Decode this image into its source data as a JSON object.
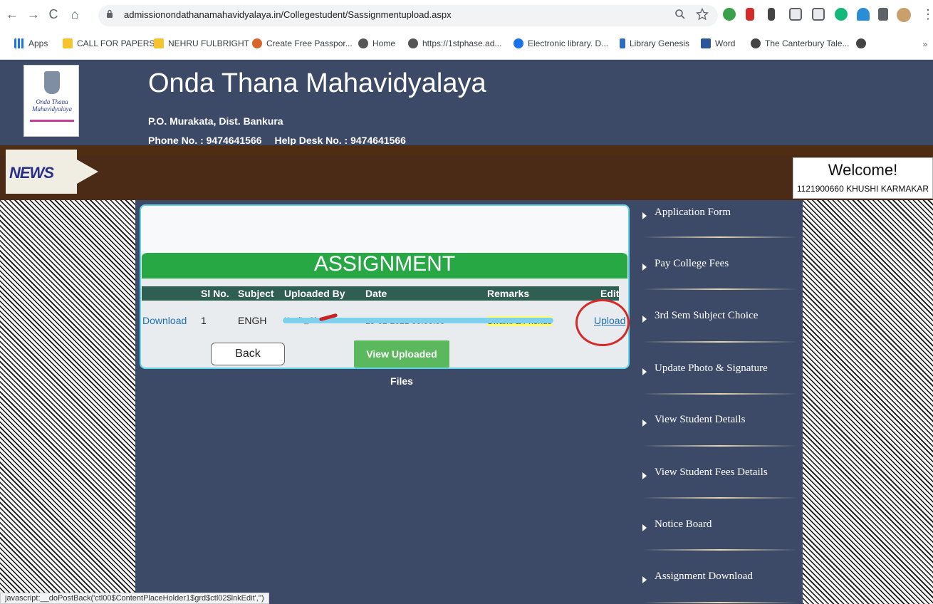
{
  "browser": {
    "url": "admissionondathanamahavidyalaya.in/Collegestudent/Sassignmentupload.aspx",
    "nav": {
      "back": "←",
      "forward": "→",
      "reload": "C",
      "home": "⌂"
    },
    "bookmarks": [
      {
        "label": "Apps",
        "color": "#1a73e8"
      },
      {
        "label": "CALL FOR PAPERS",
        "color": "#f4c430"
      },
      {
        "label": "NEHRU FULBRIGHT",
        "color": "#f4c430"
      },
      {
        "label": "Create Free Passpor...",
        "color": "#d9642a"
      },
      {
        "label": "Home",
        "color": "#555555"
      },
      {
        "label": "https://1stphase.ad...",
        "color": "#555555"
      },
      {
        "label": "Electronic library. D...",
        "color": "#1a73e8"
      },
      {
        "label": "Library Genesis",
        "color": "#2d6cc0"
      },
      {
        "label": "Word",
        "color": "#2b579a"
      },
      {
        "label": "The Canterbury Tale...",
        "color": "#444444"
      }
    ],
    "more": "»",
    "status": "javascript:__doPostBack('ctl00$ContentPlaceHolder1$grd$ctl02$lnkEdit','')"
  },
  "site": {
    "title": "Onda Thana Mahavidyalaya",
    "address": "P.O. Murakata, Dist. Bankura",
    "phone": "Phone No. : 9474641566",
    "helpdesk": "Help Desk No. : 9474641566",
    "logo_text": "Onda Thana Mahavidyalaya",
    "news_label": "NEWS",
    "welcome": "Welcome!",
    "user": "1121900660 KHUSHI KARMAKAR"
  },
  "assignment": {
    "title": "ASSIGNMENT",
    "columns": [
      "Sl No.",
      "Subject",
      "Uploaded By",
      "Date",
      "Remarks",
      "Edit"
    ],
    "row": {
      "action": "Download",
      "sl": "1",
      "subject": "ENGH",
      "uploaded_by": "Kartik_Chakr",
      "date": "19-02-2021 00:00:00",
      "remarks": "Swami & Friends",
      "edit": "Upload"
    },
    "back_label": "Back",
    "view_label": "View Uploaded Files"
  },
  "menu": [
    "Application Form",
    "Pay College Fees",
    "3rd Sem Subject Choice",
    "Update Photo & Signature",
    "View Student Details",
    "View Student Fees Details",
    "Notice Board",
    "Assignment Download"
  ],
  "colors": {
    "header": "#3c4a68",
    "newsbar": "#4b2b15",
    "assignment_green": "#28a745",
    "table_head": "#2f5f50",
    "annotation_red": "#d62929"
  }
}
